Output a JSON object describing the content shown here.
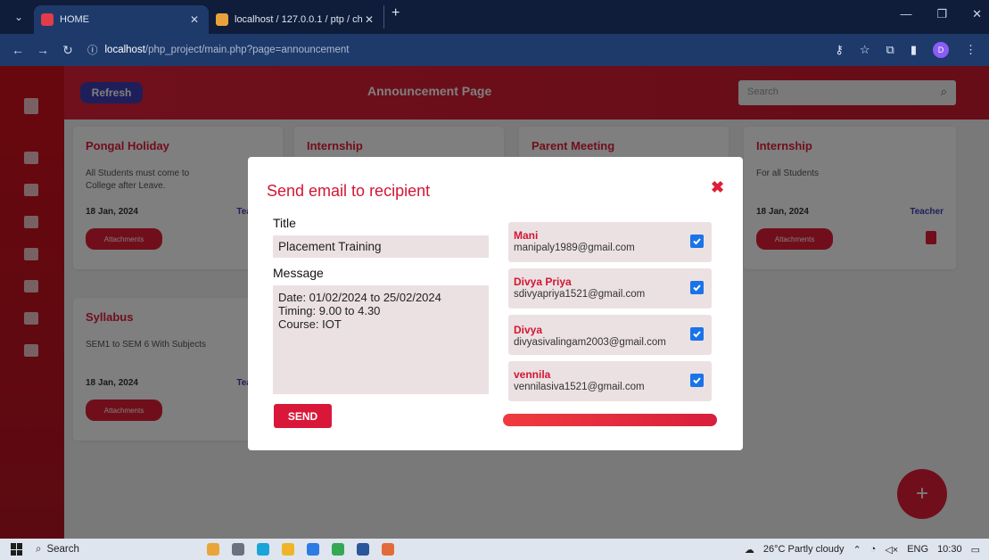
{
  "browser": {
    "tabs": [
      {
        "title": "HOME",
        "favicon_color": "#e23b4a",
        "active": true
      },
      {
        "title": "localhost / 127.0.0.1 / ptp / cha",
        "favicon_color": "#e9a23b",
        "active": false
      }
    ],
    "url_host": "localhost",
    "url_path": "/php_project/main.php?page=announcement",
    "profile_initial": "D"
  },
  "app": {
    "refresh_label": "Refresh",
    "page_title": "Announcement Page",
    "search_placeholder": "Search",
    "cards": [
      {
        "title": "Pongal Holiday",
        "desc": "All Students must come to College after Leave.",
        "date": "18 Jan, 2024",
        "author": "Teacher",
        "attach_label": "Attachments"
      },
      {
        "title": "Internship",
        "desc": "",
        "date": "",
        "author": "",
        "attach_label": ""
      },
      {
        "title": "Parent Meeting",
        "desc": "",
        "date": "",
        "author": "",
        "attach_label": ""
      },
      {
        "title": "Internship",
        "desc": "For all Students",
        "date": "18 Jan, 2024",
        "author": "Teacher",
        "attach_label": "Attachments"
      },
      {
        "title": "Syllabus",
        "desc": "SEM1 to SEM 6 With Subjects",
        "date": "18 Jan, 2024",
        "author": "Teacher",
        "attach_label": "Attachments"
      }
    ],
    "fab_label": "+"
  },
  "modal": {
    "title": "Send email to recipient",
    "close_glyph": "✖",
    "title_label": "Title",
    "title_value": "Placement Training",
    "message_label": "Message",
    "message_value": "Date: 01/02/2024 to 25/02/2024\nTiming: 9.00 to 4.30\nCourse: IOT",
    "send_label": "SEND",
    "recipients": [
      {
        "name": "Mani",
        "email": "manipaly1989@gmail.com",
        "checked": true
      },
      {
        "name": "Divya Priya",
        "email": "sdivyapriya1521@gmail.com",
        "checked": true
      },
      {
        "name": "Divya",
        "email": "divyasivalingam2003@gmail.com",
        "checked": true
      },
      {
        "name": "vennila",
        "email": "vennilasiva1521@gmail.com",
        "checked": true
      }
    ]
  },
  "taskbar": {
    "search_label": "Search",
    "weather": "26°C Partly cloudy",
    "lang": "ENG",
    "time": "10:30"
  }
}
